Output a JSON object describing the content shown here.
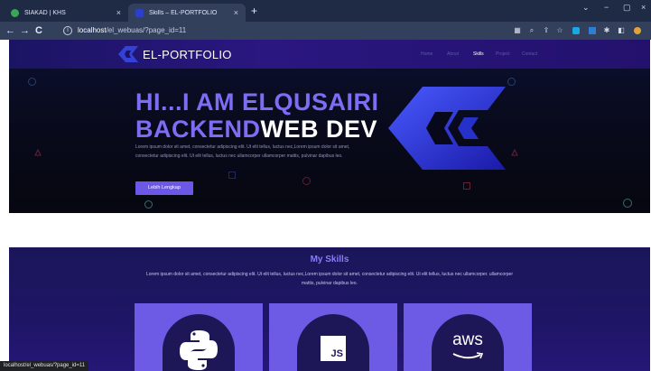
{
  "browser": {
    "tabs": [
      {
        "label": "SIAKAD | KHS",
        "active": false
      },
      {
        "label": "Skills – EL-PORTFOLIO",
        "active": true
      }
    ],
    "tab_close_glyph": "×",
    "new_tab_glyph": "+",
    "window_controls": [
      "⌄",
      "−",
      "▢",
      "×"
    ],
    "url_host": "localhost",
    "url_path": "/el_webuas/?page_id=11",
    "status_url": "localhost/el_webuas/?page_id=11",
    "nav_glyphs": {
      "back": "←",
      "forward": "→",
      "reload": "C",
      "info": "i"
    }
  },
  "site": {
    "brand": "EL-PORTFOLIO",
    "menu": [
      "Home",
      "About",
      "Skills",
      "Project",
      "Contact"
    ],
    "active_menu": "Skills",
    "colors": {
      "accent": "#7e6cf5",
      "nav": "#2a1780",
      "button": "#6b58e8"
    }
  },
  "hero": {
    "line1": "HI...I AM ELQUSAIRI",
    "line2_a": "BACKEND",
    "line2_b": "WEB DEV",
    "description": "Lorem ipsum dolor sit amet, consectetur adipiscing elit. Ut elit tellus, luctus nec,Lorem ipsum dolor sit amet, consectetur adipiscing elit. Ut elit tellus, luctus nec ullamcorper ullamcorper mattis, pulvinar dapibus leo.",
    "button_label": "Lebih Lengkap"
  },
  "skills": {
    "title": "My Skills",
    "description": "Lorem ipsum dolor sit amet, consectetur adipiscing elit. Ut elit tellus, luctus nec,Lorem ipsum dolor sit amet, consectetur adipiscing elit. Ut elit tellus, luctus nec ullamcorper. ullamcorper mattis, pulvinar dapibus leo.",
    "cards": [
      {
        "icon": "python-icon",
        "label": ""
      },
      {
        "icon": "javascript-icon",
        "label": "JS"
      },
      {
        "icon": "aws-icon",
        "label": "aws"
      }
    ]
  }
}
